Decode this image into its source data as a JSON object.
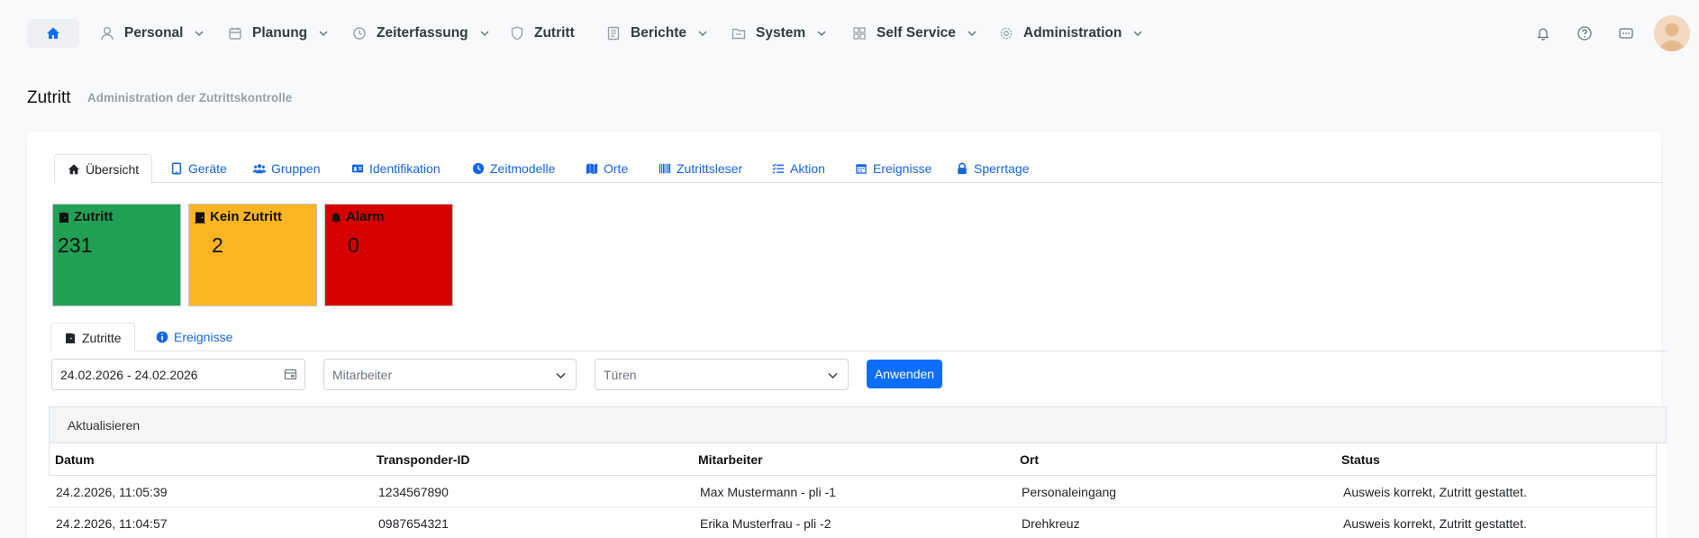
{
  "nav": {
    "items": [
      {
        "label": "Personal",
        "icon": "user-icon"
      },
      {
        "label": "Planung",
        "icon": "calendar-icon"
      },
      {
        "label": "Zeiterfassung",
        "icon": "clock-icon"
      },
      {
        "label": "Zutritt",
        "icon": "shield-icon"
      },
      {
        "label": "Berichte",
        "icon": "report-icon"
      },
      {
        "label": "System",
        "icon": "folder-icon"
      },
      {
        "label": "Self Service",
        "icon": "grid-icon"
      },
      {
        "label": "Administration",
        "icon": "gear-icon"
      }
    ]
  },
  "page": {
    "title": "Zutritt",
    "subtitle": "Administration der Zutrittskontrolle"
  },
  "tabs": [
    {
      "label": "Übersicht",
      "icon": "home-icon"
    },
    {
      "label": "Geräte",
      "icon": "tablet-icon"
    },
    {
      "label": "Gruppen",
      "icon": "users-icon"
    },
    {
      "label": "Identifikation",
      "icon": "id-card-icon"
    },
    {
      "label": "Zeitmodelle",
      "icon": "clock-icon"
    },
    {
      "label": "Orte",
      "icon": "map-icon"
    },
    {
      "label": "Zutrittsleser",
      "icon": "barcode-icon"
    },
    {
      "label": "Aktion",
      "icon": "list-check-icon"
    },
    {
      "label": "Ereignisse",
      "icon": "calendar-icon"
    },
    {
      "label": "Sperrtage",
      "icon": "lock-icon"
    }
  ],
  "tiles": [
    {
      "label": "Zutritt",
      "value": "231",
      "color": "#22a055"
    },
    {
      "label": "Kein Zutritt",
      "value": "2",
      "color": "#fbb522"
    },
    {
      "label": "Alarm",
      "value": "0",
      "color": "#d60000"
    }
  ],
  "subtabs": [
    {
      "label": "Zutritte",
      "icon": "door-icon"
    },
    {
      "label": "Ereignisse",
      "icon": "info-icon"
    }
  ],
  "filters": {
    "date_range": "24.02.2026 - 24.02.2026",
    "employee_placeholder": "Mitarbeiter",
    "doors_placeholder": "Türen",
    "apply_label": "Anwenden"
  },
  "grid": {
    "refresh_label": "Aktualisieren",
    "columns": [
      "Datum",
      "Transponder-ID",
      "Mitarbeiter",
      "Ort",
      "Status"
    ],
    "rows": [
      [
        "24.2.2026, 11:05:39",
        "1234567890",
        "Max Mustermann - pli -1",
        "Personaleingang",
        "Ausweis korrekt, Zutritt gestattet."
      ],
      [
        "24.2.2026, 11:04:57",
        "0987654321",
        "Erika Musterfrau - pli -2",
        "Drehkreuz",
        "Ausweis korrekt, Zutritt gestattet."
      ]
    ]
  },
  "colors": {
    "accent": "#0d6efd",
    "link": "#1565e0"
  }
}
